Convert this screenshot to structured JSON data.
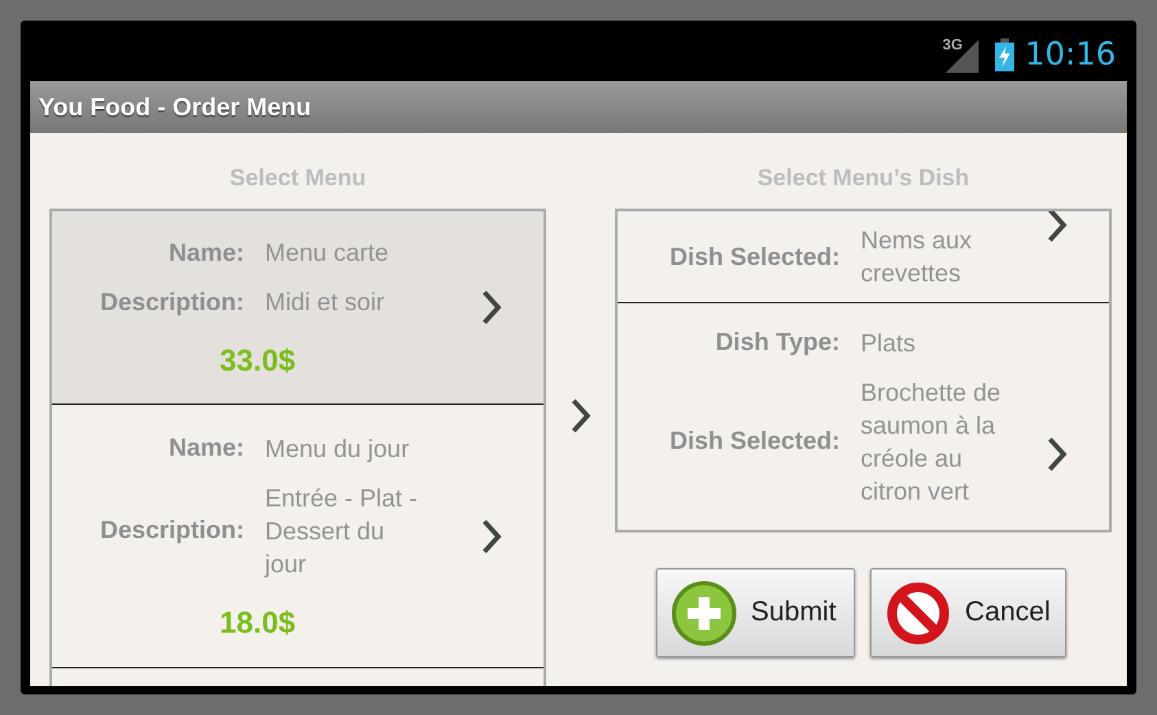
{
  "status_bar": {
    "network": "3G",
    "time": "10:16"
  },
  "title": "You Food - Order Menu",
  "menus": {
    "heading": "Select Menu",
    "items": [
      {
        "fields": [
          {
            "label": "Name:",
            "value": "Menu carte"
          },
          {
            "label": "Description:",
            "value": "Midi et soir"
          }
        ],
        "price": "33.0$",
        "selected": true
      },
      {
        "fields": [
          {
            "label": "Name:",
            "value": "Menu du jour"
          },
          {
            "label": "Description:",
            "value": "Entrée - Plat - Dessert du jour"
          }
        ],
        "price": "18.0$",
        "selected": false
      }
    ]
  },
  "dishes": {
    "heading": "Select Menu’s Dish",
    "items": [
      {
        "fields": [
          {
            "label": "Dish Selected:",
            "value": "Nems aux crevettes"
          }
        ]
      },
      {
        "fields": [
          {
            "label": "Dish Type:",
            "value": "Plats"
          },
          {
            "label": "Dish Selected:",
            "value": "Brochette de saumon à la créole au citron vert"
          }
        ]
      }
    ]
  },
  "buttons": [
    {
      "label": "Submit",
      "kind": "add"
    },
    {
      "label": "Cancel",
      "kind": "cancel"
    }
  ]
}
